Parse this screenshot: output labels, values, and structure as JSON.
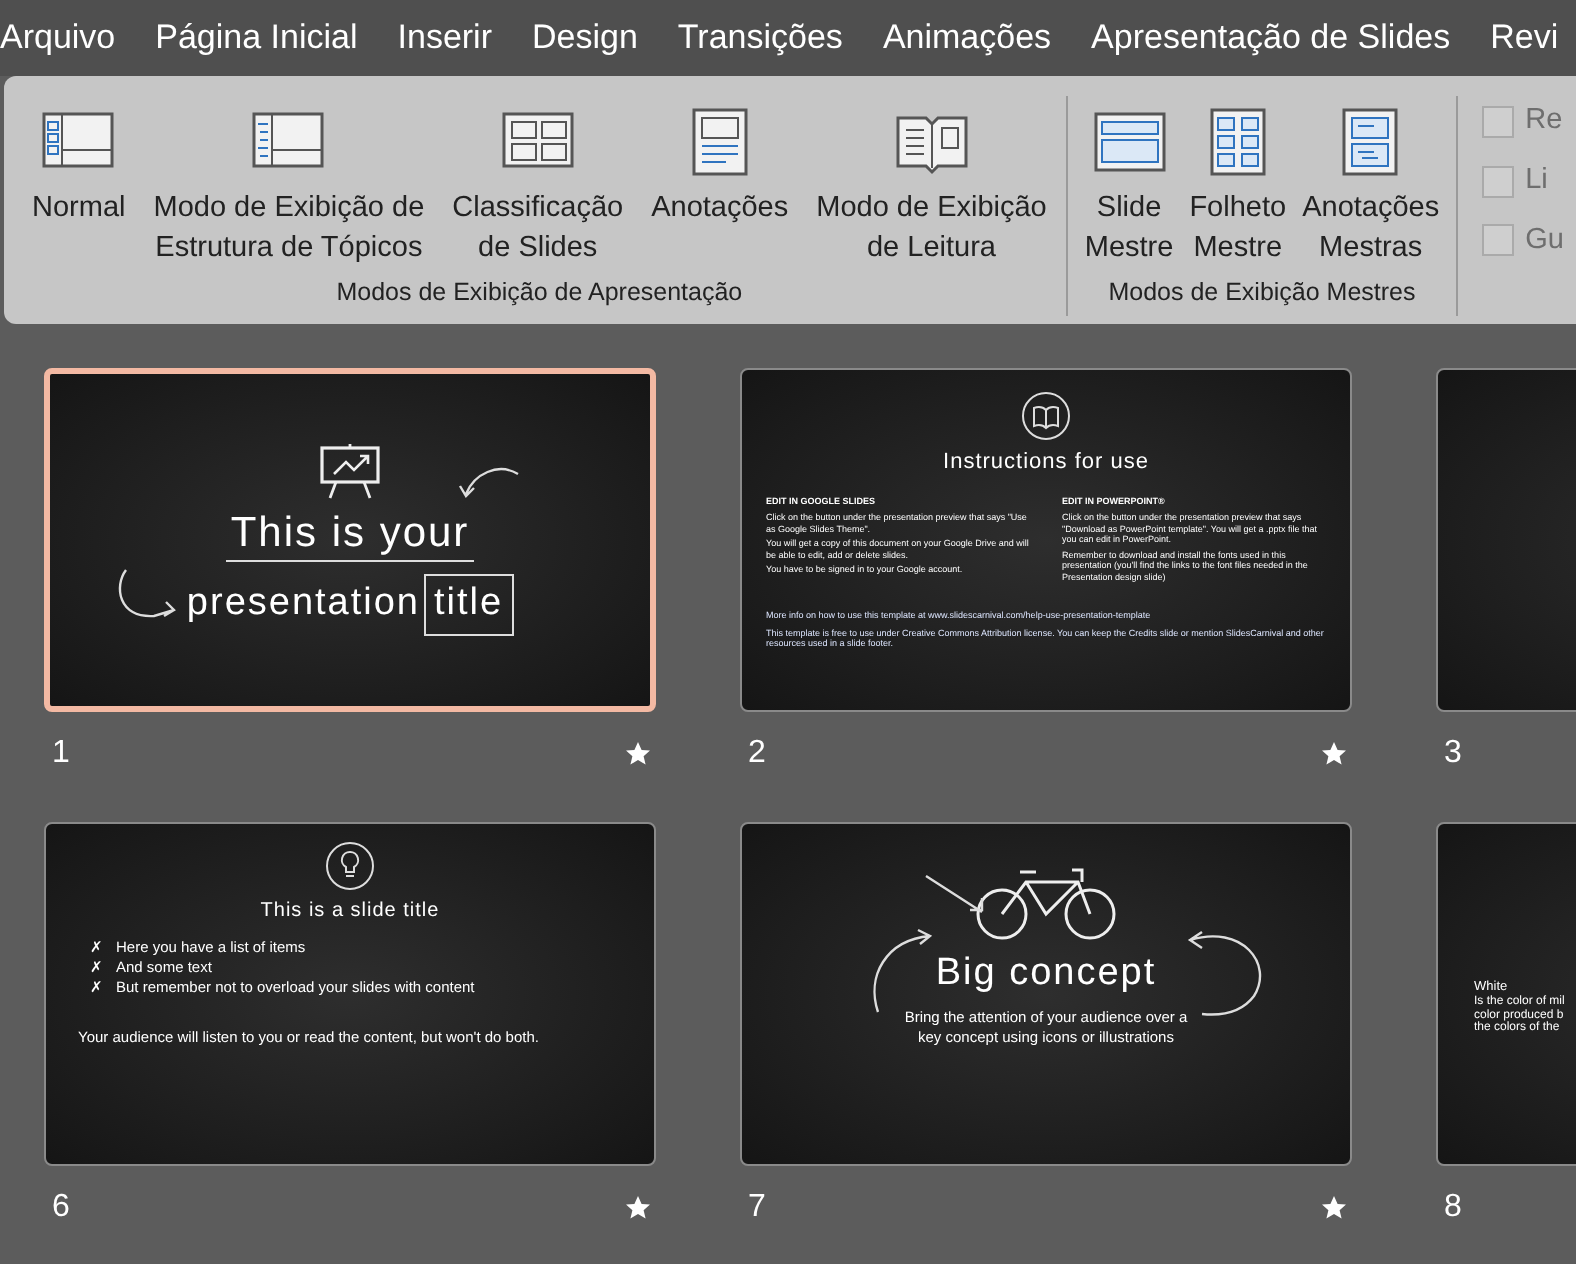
{
  "tabs": [
    {
      "label": "Arquivo"
    },
    {
      "label": "Página Inicial"
    },
    {
      "label": "Inserir"
    },
    {
      "label": "Design"
    },
    {
      "label": "Transições"
    },
    {
      "label": "Animações"
    },
    {
      "label": "Apresentação de Slides"
    },
    {
      "label": "Revi"
    }
  ],
  "ribbon": {
    "groups": [
      {
        "label": "Modos de Exibição de Apresentação",
        "buttons": [
          {
            "kind": "normal",
            "label": [
              "Normal"
            ]
          },
          {
            "kind": "outline",
            "label": [
              "Modo de Exibição de",
              "Estrutura de Tópicos"
            ]
          },
          {
            "kind": "sorter",
            "label": [
              "Classificação",
              "de Slides"
            ]
          },
          {
            "kind": "notes",
            "label": [
              "Anotações"
            ]
          },
          {
            "kind": "reading",
            "label": [
              "Modo de Exibição",
              "de Leitura"
            ]
          }
        ]
      },
      {
        "label": "Modos de Exibição Mestres",
        "buttons": [
          {
            "kind": "slide_master",
            "label": [
              "Slide",
              "Mestre"
            ]
          },
          {
            "kind": "handout_master",
            "label": [
              "Folheto",
              "Mestre"
            ]
          },
          {
            "kind": "notes_master",
            "label": [
              "Anotações",
              "Mestras"
            ]
          }
        ]
      }
    ],
    "checkboxes": [
      {
        "label": "Re",
        "checked": false,
        "disabled": true
      },
      {
        "label": "Li",
        "checked": false,
        "disabled": true
      },
      {
        "label": "Gu",
        "checked": false,
        "disabled": true
      }
    ]
  },
  "slides": [
    {
      "number": "1",
      "selected": true,
      "kind": "title",
      "title": "This is your",
      "title_2": "presentation",
      "boxed": "title"
    },
    {
      "number": "2",
      "selected": false,
      "kind": "instructions",
      "title": "Instructions for use",
      "columns": [
        {
          "heading": "EDIT IN GOOGLE SLIDES",
          "paragraphs": [
            "Click on the button under the presentation preview that says \"Use as Google Slides Theme\".",
            "You will get a copy of this document on your Google Drive and will be able to edit, add or delete slides.",
            "You have to be signed in to your Google account."
          ]
        },
        {
          "heading": "EDIT IN POWERPOINT®",
          "paragraphs": [
            "Click on the button under the presentation preview that says \"Download as PowerPoint template\". You will get a .pptx file that you can edit in PowerPoint.",
            "Remember to download and install the fonts used in this presentation (you'll find the links to the font files needed in the Presentation design slide)"
          ]
        }
      ],
      "footer": [
        "More info on how to use this template at www.slidescarnival.com/help-use-presentation-template",
        "This template is free to use under Creative Commons Attribution license. You can keep the Credits slide or mention SlidesCarnival and other resources used in a slide footer."
      ]
    },
    {
      "number": "3",
      "selected": false,
      "kind": "blank"
    },
    {
      "number": "6",
      "selected": false,
      "kind": "list",
      "title": "This is a slide title",
      "bullet": "✗",
      "items": [
        "Here you have a list of items",
        "And some text",
        "But remember not to overload your slides with content"
      ],
      "body": "Your audience will listen to you or read the content, but won't do both."
    },
    {
      "number": "7",
      "selected": false,
      "kind": "concept",
      "title": "Big concept",
      "body": "Bring the attention of your audience over a key concept using icons or illustrations"
    },
    {
      "number": "8",
      "selected": false,
      "kind": "partial",
      "heading": "White",
      "lines": [
        "Is the color of mil",
        "color produced b",
        "the colors of the"
      ]
    }
  ]
}
